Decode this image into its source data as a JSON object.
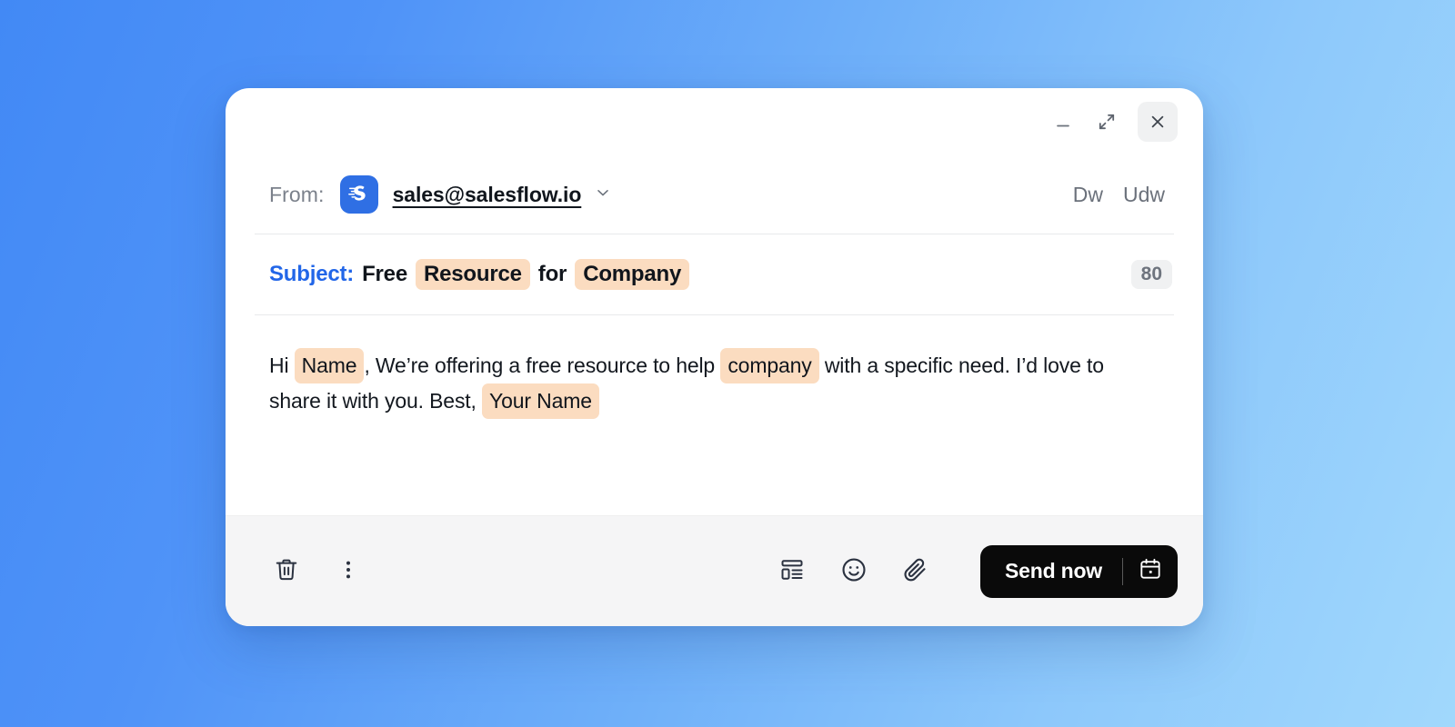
{
  "window": {
    "controls": {
      "minimize_label": "Minimize",
      "expand_label": "Expand",
      "close_label": "Close"
    }
  },
  "from": {
    "label": "From:",
    "email": "sales@salesflow.io",
    "avatar_icon": "salesflow-logo-icon",
    "avatar_color": "#2f6fe4",
    "caret_icon": "chevron-down-icon",
    "right_actions": [
      {
        "label": "Dw"
      },
      {
        "label": "Udw"
      }
    ]
  },
  "subject": {
    "label": "Subject:",
    "parts": [
      {
        "type": "text",
        "text": "Free"
      },
      {
        "type": "token",
        "text": "Resource"
      },
      {
        "type": "text",
        "text": "for"
      },
      {
        "type": "token",
        "text": "Company"
      }
    ],
    "char_count": "80"
  },
  "body": {
    "parts": [
      {
        "type": "text",
        "text": "Hi "
      },
      {
        "type": "token",
        "text": "Name"
      },
      {
        "type": "text",
        "text": ", We’re offering a free resource to help "
      },
      {
        "type": "token",
        "text": "company"
      },
      {
        "type": "text",
        "text": " with a specific need. I’d love to share it with you. Best, "
      },
      {
        "type": "token",
        "text": "Your Name"
      }
    ]
  },
  "toolbar": {
    "left_items": [
      {
        "name": "delete-draft-button",
        "icon": "trash-icon"
      },
      {
        "name": "more-options-button",
        "icon": "more-vertical-icon"
      }
    ],
    "right_items": [
      {
        "name": "template-button",
        "icon": "layout-template-icon"
      },
      {
        "name": "emoji-button",
        "icon": "smiley-icon"
      },
      {
        "name": "attachment-button",
        "icon": "paperclip-icon"
      }
    ],
    "send_label": "Send now",
    "schedule_icon": "calendar-icon"
  },
  "theme": {
    "accent_blue": "#2266e8",
    "token_highlight": "#fbdcc0",
    "send_button_bg": "#0a0a0a",
    "footer_bg": "#f5f5f6",
    "backdrop_from": "#4289f5",
    "backdrop_to": "#a1d8fc"
  }
}
